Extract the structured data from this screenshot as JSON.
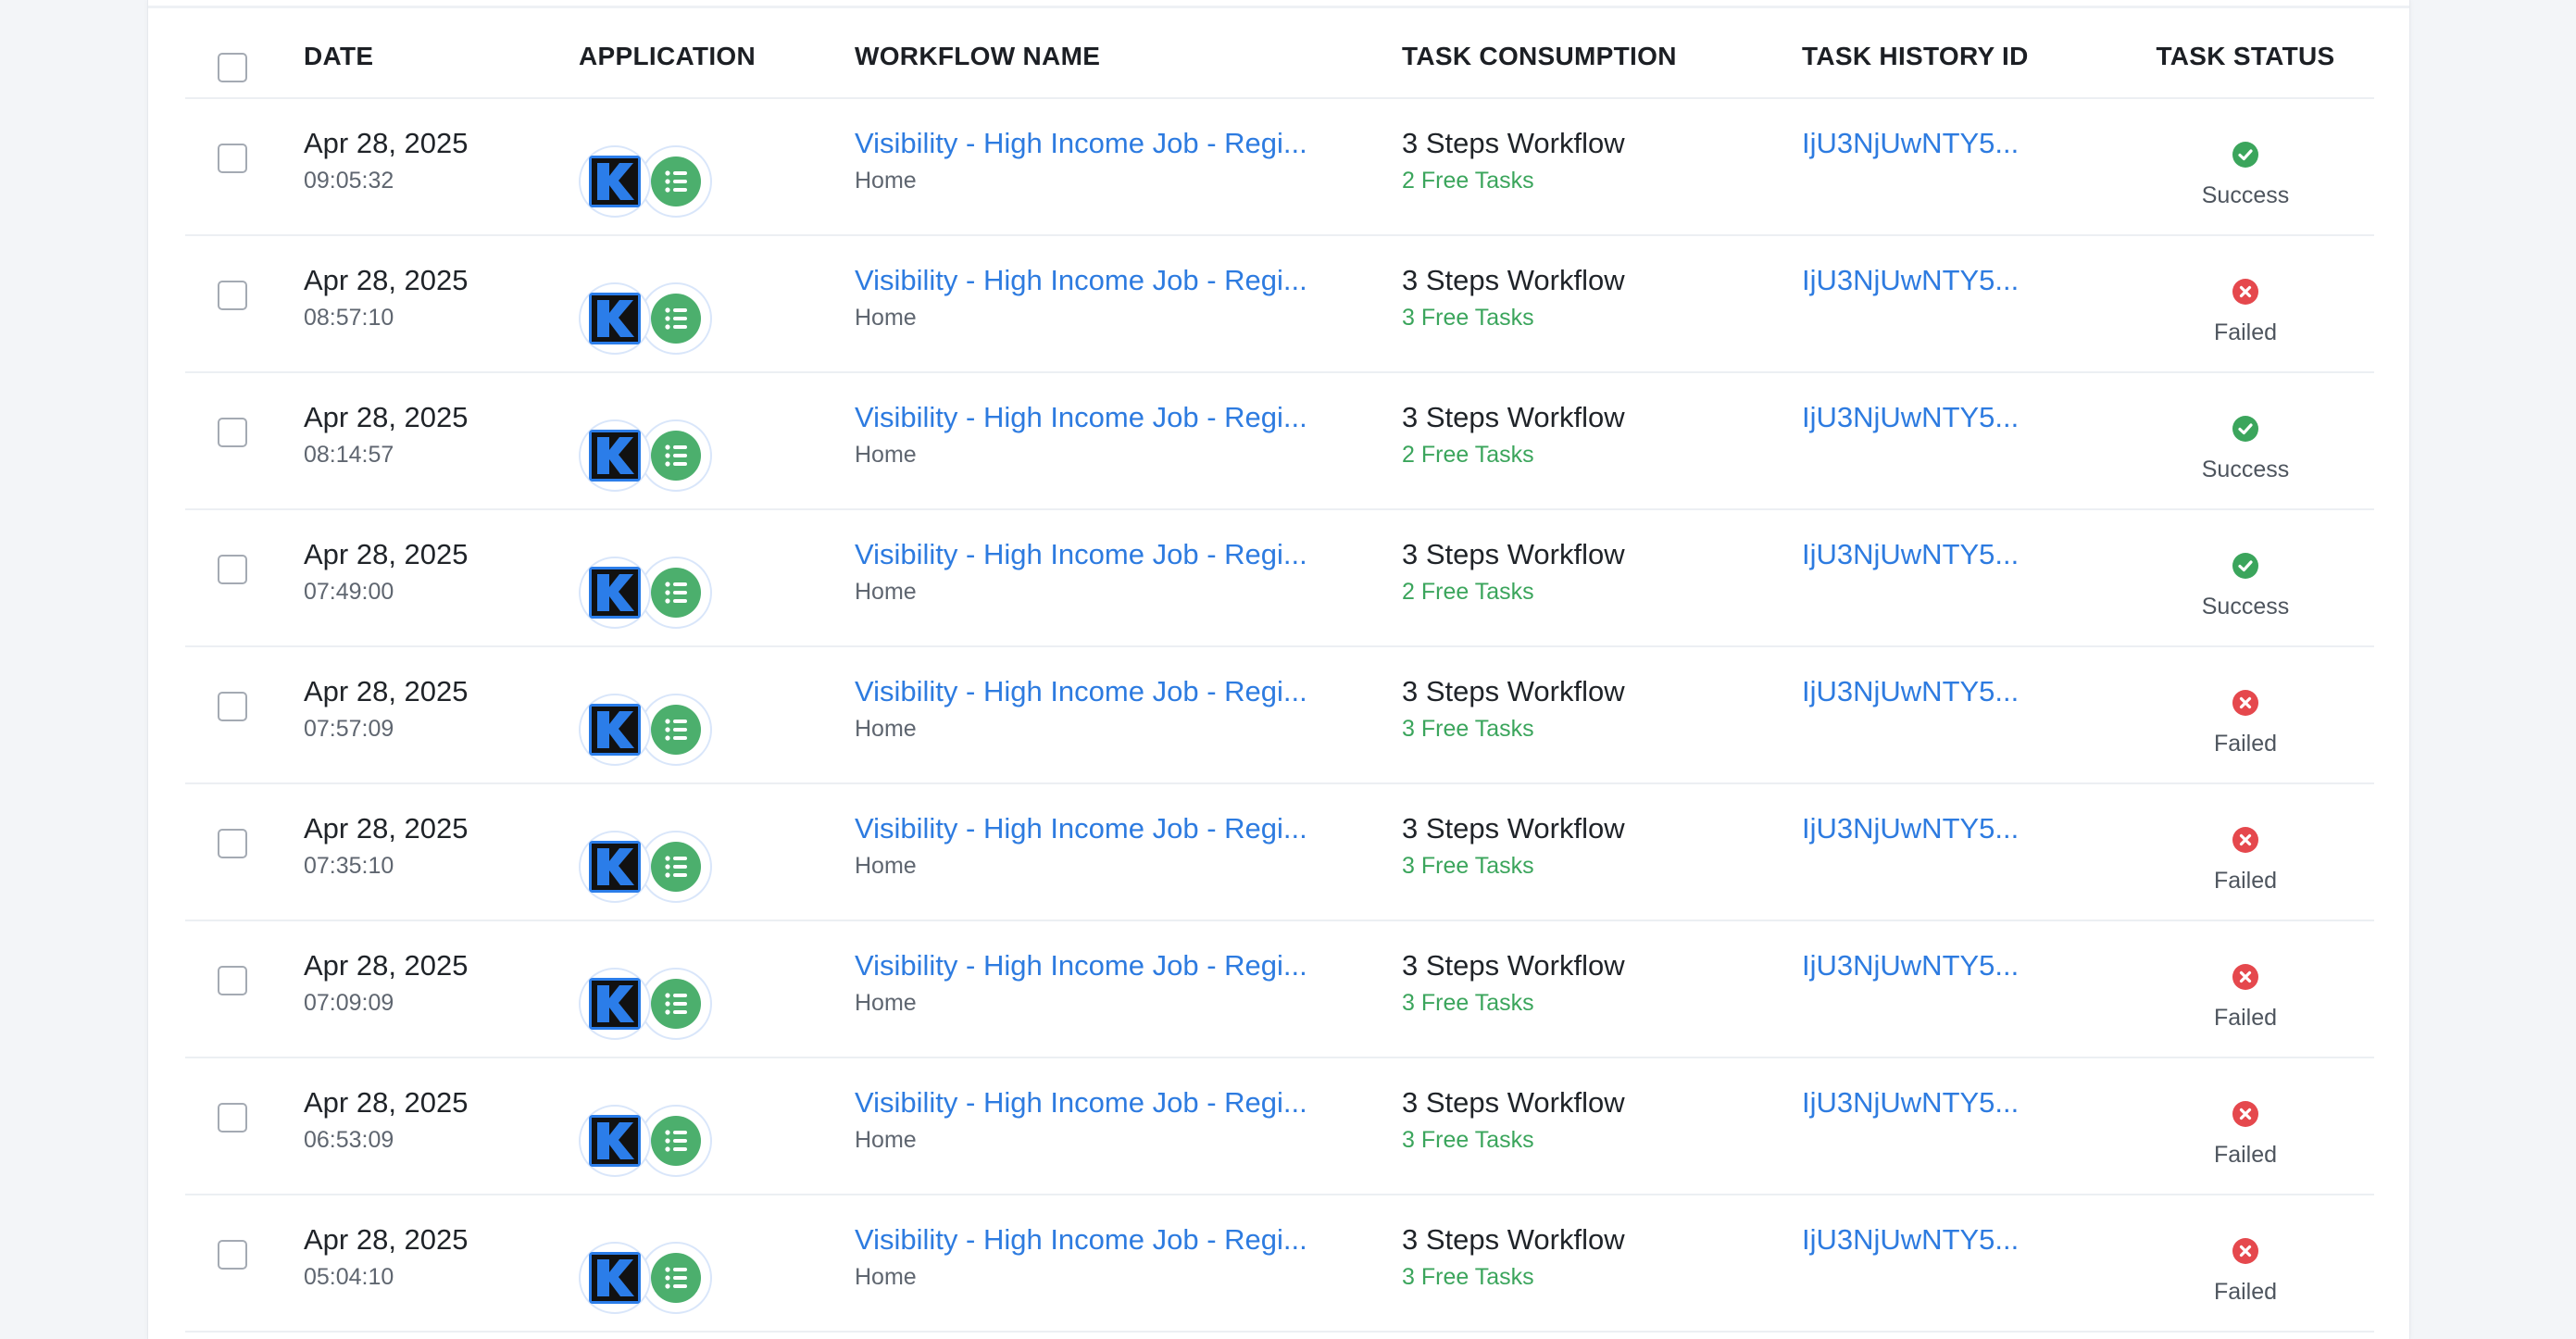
{
  "headers": {
    "date": "DATE",
    "application": "APPLICATION",
    "workflow_name": "WORKFLOW NAME",
    "task_consumption": "TASK CONSUMPTION",
    "task_history_id": "TASK HISTORY ID",
    "task_status": "TASK STATUS"
  },
  "colors": {
    "link": "#2d7be0",
    "success": "#3ba55c",
    "failed": "#e5484d",
    "green_app": "#4caf6d"
  },
  "rows": [
    {
      "date": "Apr 28, 2025",
      "time": "09:05:32",
      "workflow": "Visibility - High Income Job - Regi...",
      "folder": "Home",
      "consumption": "3 Steps Workflow",
      "free_tasks": "2 Free Tasks",
      "history_id": "IjU3NjUwNTY5...",
      "status": "Success",
      "status_icon": "check-circle-icon"
    },
    {
      "date": "Apr 28, 2025",
      "time": "08:57:10",
      "workflow": "Visibility - High Income Job - Regi...",
      "folder": "Home",
      "consumption": "3 Steps Workflow",
      "free_tasks": "3 Free Tasks",
      "history_id": "IjU3NjUwNTY5...",
      "status": "Failed",
      "status_icon": "x-circle-icon"
    },
    {
      "date": "Apr 28, 2025",
      "time": "08:14:57",
      "workflow": "Visibility - High Income Job - Regi...",
      "folder": "Home",
      "consumption": "3 Steps Workflow",
      "free_tasks": "2 Free Tasks",
      "history_id": "IjU3NjUwNTY5...",
      "status": "Success",
      "status_icon": "check-circle-icon"
    },
    {
      "date": "Apr 28, 2025",
      "time": "07:49:00",
      "workflow": "Visibility - High Income Job - Regi...",
      "folder": "Home",
      "consumption": "3 Steps Workflow",
      "free_tasks": "2 Free Tasks",
      "history_id": "IjU3NjUwNTY5...",
      "status": "Success",
      "status_icon": "check-circle-icon"
    },
    {
      "date": "Apr 28, 2025",
      "time": "07:57:09",
      "workflow": "Visibility - High Income Job - Regi...",
      "folder": "Home",
      "consumption": "3 Steps Workflow",
      "free_tasks": "3 Free Tasks",
      "history_id": "IjU3NjUwNTY5...",
      "status": "Failed",
      "status_icon": "x-circle-icon"
    },
    {
      "date": "Apr 28, 2025",
      "time": "07:35:10",
      "workflow": "Visibility - High Income Job - Regi...",
      "folder": "Home",
      "consumption": "3 Steps Workflow",
      "free_tasks": "3 Free Tasks",
      "history_id": "IjU3NjUwNTY5...",
      "status": "Failed",
      "status_icon": "x-circle-icon"
    },
    {
      "date": "Apr 28, 2025",
      "time": "07:09:09",
      "workflow": "Visibility - High Income Job - Regi...",
      "folder": "Home",
      "consumption": "3 Steps Workflow",
      "free_tasks": "3 Free Tasks",
      "history_id": "IjU3NjUwNTY5...",
      "status": "Failed",
      "status_icon": "x-circle-icon"
    },
    {
      "date": "Apr 28, 2025",
      "time": "06:53:09",
      "workflow": "Visibility - High Income Job - Regi...",
      "folder": "Home",
      "consumption": "3 Steps Workflow",
      "free_tasks": "3 Free Tasks",
      "history_id": "IjU3NjUwNTY5...",
      "status": "Failed",
      "status_icon": "x-circle-icon"
    },
    {
      "date": "Apr 28, 2025",
      "time": "05:04:10",
      "workflow": "Visibility - High Income Job - Regi...",
      "folder": "Home",
      "consumption": "3 Steps Workflow",
      "free_tasks": "3 Free Tasks",
      "history_id": "IjU3NjUwNTY5...",
      "status": "Failed",
      "status_icon": "x-circle-icon"
    }
  ]
}
